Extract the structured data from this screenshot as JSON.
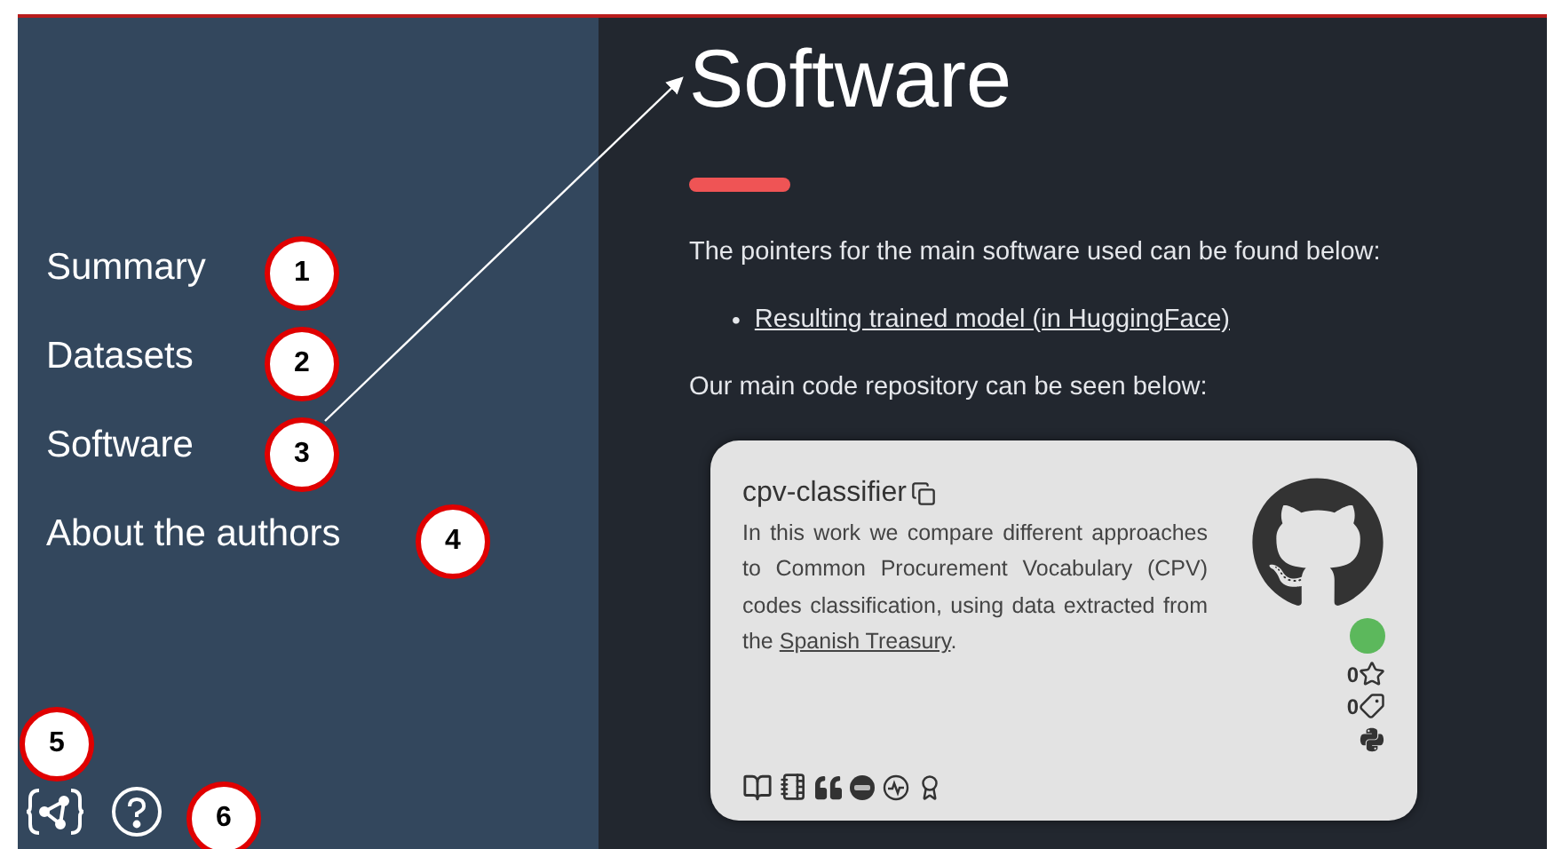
{
  "sidebar": {
    "items": [
      {
        "label": "Summary"
      },
      {
        "label": "Datasets"
      },
      {
        "label": "Software"
      },
      {
        "label": "About the authors"
      }
    ]
  },
  "main": {
    "title": "Software",
    "intro": "The pointers for the main software used can be found below:",
    "links": [
      {
        "bullet": "•",
        "label": "Resulting trained model (in HuggingFace)"
      }
    ],
    "repo_intro": "Our main code repository can be seen below:",
    "repo_card": {
      "name": "cpv-classifier",
      "description_before": "In this work we compare different approaches to Common Procurement Vocabulary (CPV) codes classification, using data extracted from the",
      "description_link": "Spanish Treasury",
      "description_after": ".",
      "stars": "0",
      "tags": "0"
    }
  },
  "callouts": [
    {
      "label": "1"
    },
    {
      "label": "2"
    },
    {
      "label": "3"
    },
    {
      "label": "4"
    },
    {
      "label": "5"
    },
    {
      "label": "6"
    }
  ]
}
